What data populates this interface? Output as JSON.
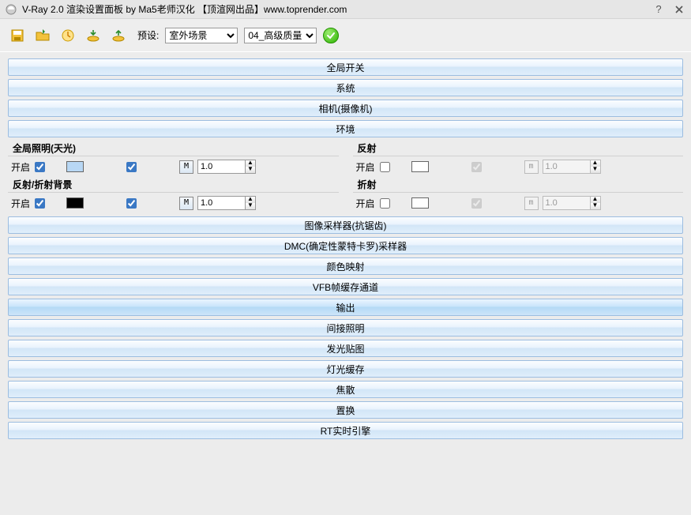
{
  "window": {
    "title": "V-Ray 2.0 渲染设置面板 by Ma5老师汉化 【顶渲网出品】www.toprender.com"
  },
  "toolbar": {
    "preset_label": "预设:",
    "preset1_selected": "室外场景",
    "preset1_options": [
      "室外场景"
    ],
    "preset2_selected": "04_高级质量",
    "preset2_options": [
      "04_高级质量"
    ]
  },
  "sections": [
    {
      "id": "global-switches",
      "label": "全局开关"
    },
    {
      "id": "system",
      "label": "系统"
    },
    {
      "id": "camera",
      "label": "相机(摄像机)"
    },
    {
      "id": "environment",
      "label": "环境"
    }
  ],
  "env": {
    "gi": {
      "title": "全局照明(天光)",
      "enable_label": "开启",
      "enabled": true,
      "swatch": "sky",
      "chk2": true,
      "m_label": "M",
      "value": "1.0"
    },
    "refl": {
      "title": "反射",
      "enable_label": "开启",
      "enabled": false,
      "swatch": "white",
      "chk2": false,
      "m_label": "m",
      "value": "1.0"
    },
    "bg": {
      "title": "反射/折射背景",
      "enable_label": "开启",
      "enabled": true,
      "swatch": "black",
      "chk2": true,
      "m_label": "M",
      "value": "1.0"
    },
    "refr": {
      "title": "折射",
      "enable_label": "开启",
      "enabled": false,
      "swatch": "white",
      "chk2": false,
      "m_label": "m",
      "value": "1.0"
    }
  },
  "sections_after": [
    {
      "id": "image-sampler",
      "label": "图像采样器(抗锯齿)"
    },
    {
      "id": "dmc",
      "label": "DMC(确定性蒙特卡罗)采样器"
    },
    {
      "id": "color-mapping",
      "label": "颜色映射"
    },
    {
      "id": "vfb",
      "label": "VFB帧缓存通道"
    },
    {
      "id": "output",
      "label": "输出",
      "selected": true
    },
    {
      "id": "indirect",
      "label": "间接照明"
    },
    {
      "id": "irradiance",
      "label": "发光贴图"
    },
    {
      "id": "lightcache",
      "label": "灯光缓存"
    },
    {
      "id": "caustics",
      "label": "焦散"
    },
    {
      "id": "displacement",
      "label": "置换"
    },
    {
      "id": "rt",
      "label": "RT实时引擎"
    }
  ]
}
